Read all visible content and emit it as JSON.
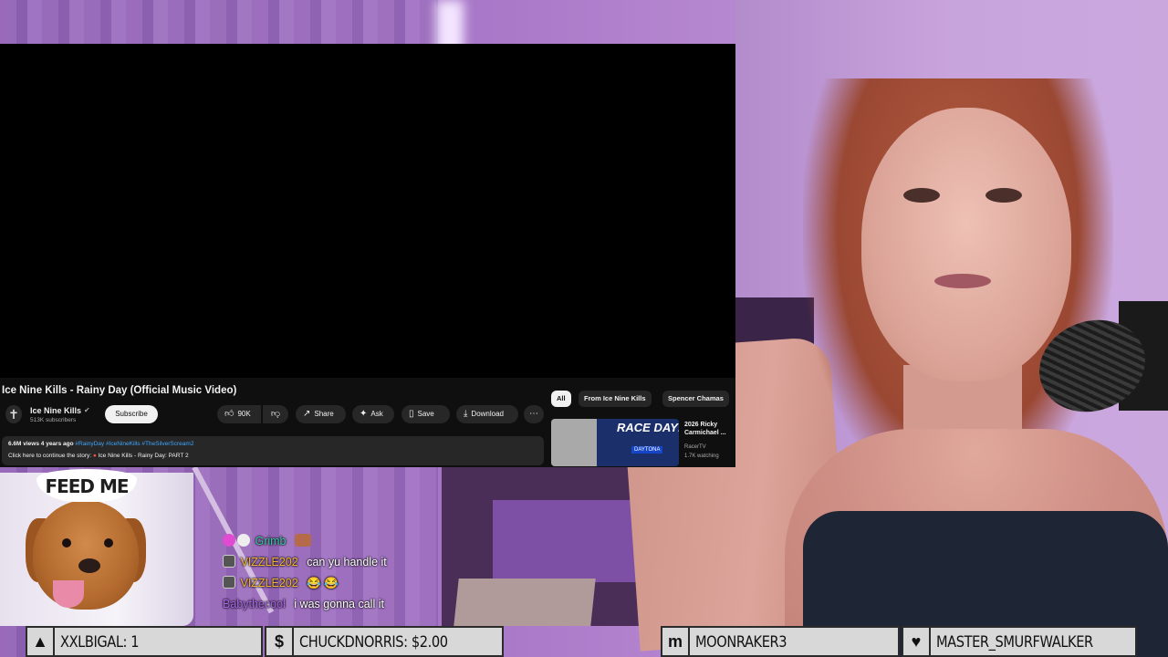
{
  "youtube": {
    "video_title": "Ice Nine Kills - Rainy Day (Official Music Video)",
    "channel_name": "Ice Nine Kills",
    "subscribers": "513K subscribers",
    "subscribe_label": "Subscribe",
    "like_count": "90K",
    "share_label": "Share",
    "ask_label": "Ask",
    "save_label": "Save",
    "download_label": "Download",
    "description": {
      "views": "6.6M views",
      "age": "4 years ago",
      "tags": "#RainyDay #IceNineKills #TheSilverScream2",
      "continue_text": "Click here to continue the story:",
      "continue_link": "Ice Nine Kills - Rainy Day: PART 2"
    },
    "chips": [
      "All",
      "From Ice Nine Kills",
      "Spencer Chamas"
    ],
    "recommendation": {
      "thumb_text": "RACE DAY!",
      "thumb_sub": "DAYTONA",
      "title": "2026 Ricky Carmichael ...",
      "channel": "RacerTV",
      "meta": "1.7K watching"
    }
  },
  "dog_overlay": {
    "banner": "FEED ME"
  },
  "chat": [
    {
      "user": "Grimb",
      "user_color": "#35c7a6",
      "text": "",
      "badges": [
        "heart",
        "skull"
      ],
      "emote": true
    },
    {
      "user": "VIZZLE202",
      "user_color": "#f5b530",
      "text": "can yu handle it",
      "badges": [
        "box"
      ],
      "emote": false
    },
    {
      "user": "VIZZLE202",
      "user_color": "#f5b530",
      "text": "😂 😂",
      "badges": [
        "box"
      ],
      "emote": false
    },
    {
      "user": "Babythecool",
      "user_color": "#a866e8",
      "text": "i was gonna call it",
      "badges": [],
      "emote": false
    }
  ],
  "alerts": [
    {
      "icon": "▲",
      "icon_name": "triangle-icon",
      "label": "XXLBIGAL: 1"
    },
    {
      "icon": "$",
      "icon_name": "dollar-icon",
      "label": "CHUCKDNORRIS: $2.00"
    },
    {
      "icon": "m",
      "icon_name": "m-logo-icon",
      "label": "MOONRAKER3"
    },
    {
      "icon": "♥",
      "icon_name": "heart-icon",
      "label": "MASTER_SMURFWALKER"
    }
  ],
  "colors": {
    "yt_bg": "#0f0f0f",
    "yt_text": "#f1f1f1",
    "yt_secondary": "#aaaaaa",
    "yt_pill": "#272727",
    "alert_bar": "#d8d8d8"
  }
}
